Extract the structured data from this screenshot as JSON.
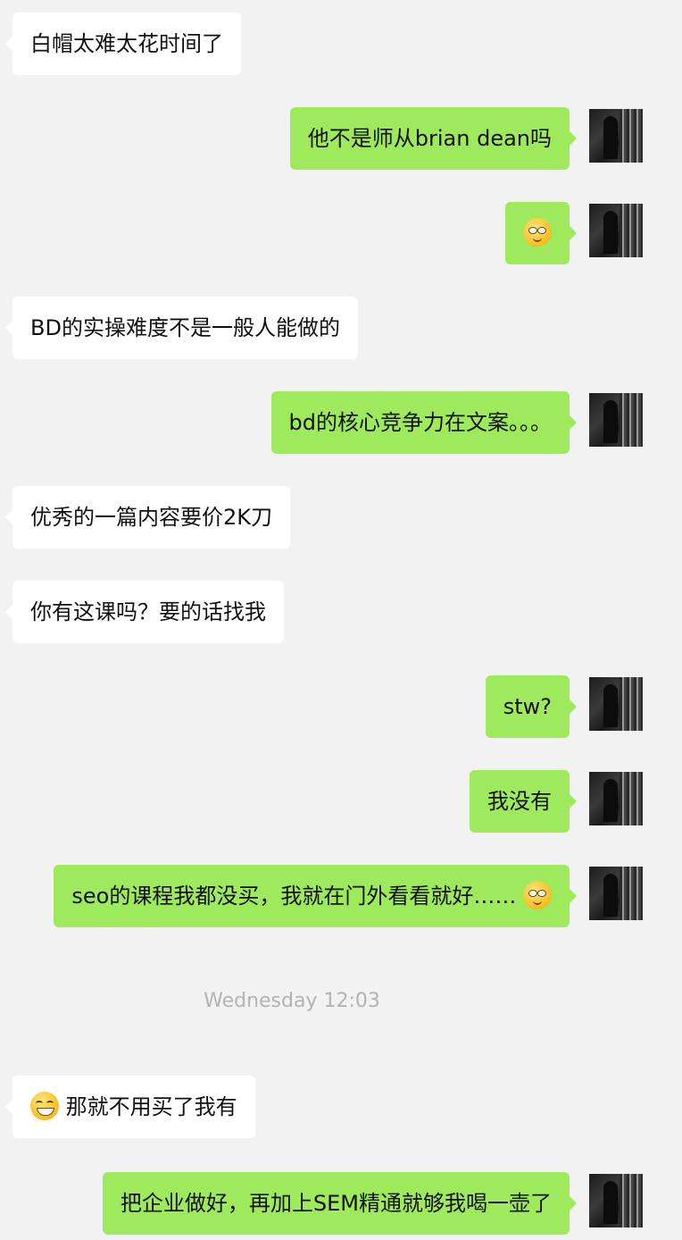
{
  "messages": [
    {
      "side": "left",
      "text": "白帽太难太花时间了"
    },
    {
      "side": "right",
      "text": "他不是师从brian dean吗"
    },
    {
      "side": "right",
      "text": "",
      "emoji": "smirk-emoji"
    },
    {
      "side": "left",
      "text": "BD的实操难度不是一般人能做的"
    },
    {
      "side": "right",
      "text": "bd的核心竞争力在文案。。。"
    },
    {
      "side": "left",
      "text": "优秀的一篇内容要价2K刀"
    },
    {
      "side": "left",
      "text": "你有这课吗？要的话找我"
    },
    {
      "side": "right",
      "text": "stw?"
    },
    {
      "side": "right",
      "text": "我没有"
    },
    {
      "side": "right",
      "text": "seo的课程我都没买，我就在门外看看就好……",
      "emoji": "smirk-emoji"
    },
    {
      "side": "left",
      "text": "那就不用买了我有",
      "emoji_before": "grin-emoji"
    },
    {
      "side": "right",
      "text": "把企业做好，再加上SEM精通就够我喝一壶了"
    }
  ],
  "timestamp": "Wednesday 12:03",
  "colors": {
    "background": "#f2f2f2",
    "incoming": "#ffffff",
    "outgoing": "#9ee95c",
    "timestamp": "#b3b3b3"
  }
}
